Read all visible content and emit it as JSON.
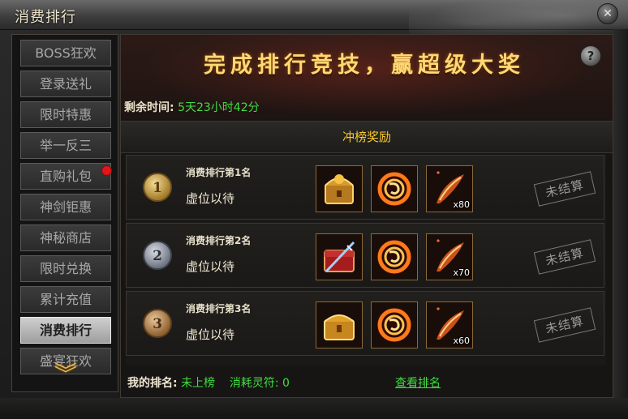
{
  "window": {
    "title": "消费排行",
    "close_glyph": "✕"
  },
  "sidebar": {
    "items": [
      {
        "label": "BOSS狂欢",
        "active": false,
        "badge": false
      },
      {
        "label": "登录送礼",
        "active": false,
        "badge": false
      },
      {
        "label": "限时特惠",
        "active": false,
        "badge": false
      },
      {
        "label": "举一反三",
        "active": false,
        "badge": false
      },
      {
        "label": "直购礼包",
        "active": false,
        "badge": true
      },
      {
        "label": "神剑钜惠",
        "active": false,
        "badge": false
      },
      {
        "label": "神秘商店",
        "active": false,
        "badge": false
      },
      {
        "label": "限时兑换",
        "active": false,
        "badge": false
      },
      {
        "label": "累计充值",
        "active": false,
        "badge": false
      },
      {
        "label": "消费排行",
        "active": true,
        "badge": false
      },
      {
        "label": "盛宴狂欢",
        "active": false,
        "badge": false
      }
    ],
    "scroll_glyph": "︾"
  },
  "banner": {
    "title": "完成排行竞技，赢超级大奖",
    "help_glyph": "?"
  },
  "timer": {
    "label": "剩余时间:",
    "value": "5天23小时42分"
  },
  "section": {
    "header": "冲榜奖励"
  },
  "ranks": [
    {
      "medal": "1",
      "title": "消费排行第1名",
      "holder": "虚位以待",
      "status": "未结算",
      "rewards": [
        {
          "icon": "golden-dragon-chest-icon",
          "qty": ""
        },
        {
          "icon": "flame-ring-icon",
          "qty": ""
        },
        {
          "icon": "flame-feather-icon",
          "qty": "x80"
        }
      ]
    },
    {
      "medal": "2",
      "title": "消费排行第2名",
      "holder": "虚位以待",
      "status": "未结算",
      "rewards": [
        {
          "icon": "red-sword-chest-icon",
          "qty": ""
        },
        {
          "icon": "flame-ring-icon",
          "qty": ""
        },
        {
          "icon": "flame-feather-icon",
          "qty": "x70"
        }
      ]
    },
    {
      "medal": "3",
      "title": "消费排行第3名",
      "holder": "虚位以待",
      "status": "未结算",
      "rewards": [
        {
          "icon": "golden-treasure-chest-icon",
          "qty": ""
        },
        {
          "icon": "flame-ring-icon",
          "qty": ""
        },
        {
          "icon": "flame-feather-icon",
          "qty": "x60"
        }
      ]
    }
  ],
  "footer": {
    "my_rank_label": "我的排名:",
    "my_rank_value": "未上榜",
    "consumed_label": "消耗灵符:",
    "consumed_value": "0",
    "view_rank_link": "查看排名"
  },
  "colors": {
    "accent_green": "#42dc42",
    "header_gold": "#f7c930",
    "banner_gold": "#ffd874",
    "badge_red": "#e0161b"
  }
}
